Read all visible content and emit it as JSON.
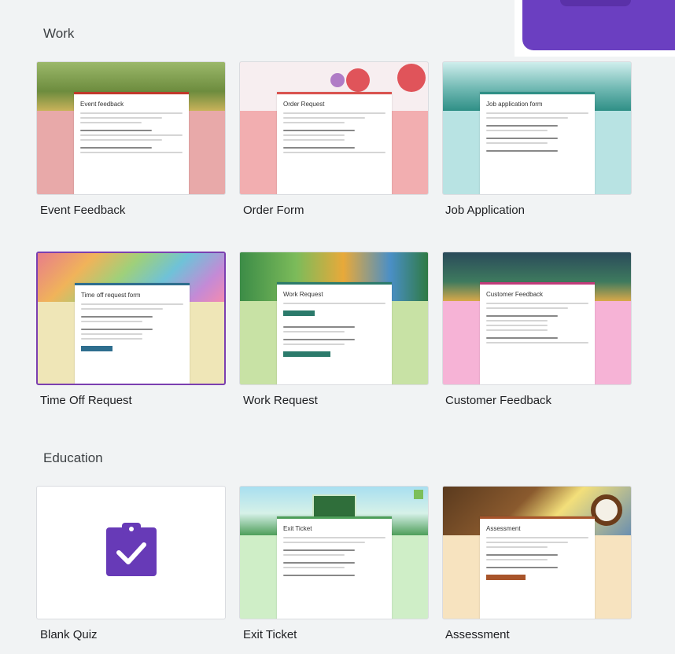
{
  "sections": {
    "work_title": "Work",
    "education_title": "Education"
  },
  "templates": {
    "event_feedback": {
      "label": "Event Feedback",
      "preview_title": "Event feedback"
    },
    "order_form": {
      "label": "Order Form",
      "preview_title": "Order Request"
    },
    "job_application": {
      "label": "Job Application",
      "preview_title": "Job application form"
    },
    "time_off": {
      "label": "Time Off Request",
      "preview_title": "Time off request form"
    },
    "work_request": {
      "label": "Work Request",
      "preview_title": "Work Request"
    },
    "customer_feedback": {
      "label": "Customer Feedback",
      "preview_title": "Customer Feedback"
    },
    "blank_quiz": {
      "label": "Blank Quiz"
    },
    "exit_ticket": {
      "label": "Exit Ticket",
      "preview_title": "Exit Ticket"
    },
    "assessment": {
      "label": "Assessment",
      "preview_title": "Assessment"
    }
  },
  "icons": {
    "blank_quiz": "clipboard-check-icon"
  },
  "colors": {
    "accent": "#673ab7",
    "selected_border": "#7b3fb0",
    "background": "#f1f3f4"
  }
}
